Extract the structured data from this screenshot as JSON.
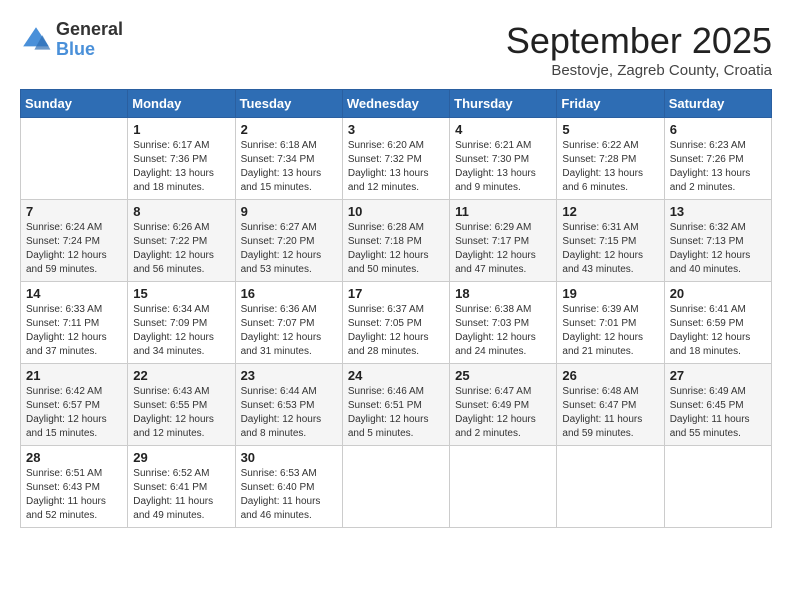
{
  "header": {
    "logo_general": "General",
    "logo_blue": "Blue",
    "month_title": "September 2025",
    "location": "Bestovje, Zagreb County, Croatia"
  },
  "days_of_week": [
    "Sunday",
    "Monday",
    "Tuesday",
    "Wednesday",
    "Thursday",
    "Friday",
    "Saturday"
  ],
  "weeks": [
    [
      {
        "day": "",
        "info": ""
      },
      {
        "day": "1",
        "info": "Sunrise: 6:17 AM\nSunset: 7:36 PM\nDaylight: 13 hours\nand 18 minutes."
      },
      {
        "day": "2",
        "info": "Sunrise: 6:18 AM\nSunset: 7:34 PM\nDaylight: 13 hours\nand 15 minutes."
      },
      {
        "day": "3",
        "info": "Sunrise: 6:20 AM\nSunset: 7:32 PM\nDaylight: 13 hours\nand 12 minutes."
      },
      {
        "day": "4",
        "info": "Sunrise: 6:21 AM\nSunset: 7:30 PM\nDaylight: 13 hours\nand 9 minutes."
      },
      {
        "day": "5",
        "info": "Sunrise: 6:22 AM\nSunset: 7:28 PM\nDaylight: 13 hours\nand 6 minutes."
      },
      {
        "day": "6",
        "info": "Sunrise: 6:23 AM\nSunset: 7:26 PM\nDaylight: 13 hours\nand 2 minutes."
      }
    ],
    [
      {
        "day": "7",
        "info": "Sunrise: 6:24 AM\nSunset: 7:24 PM\nDaylight: 12 hours\nand 59 minutes."
      },
      {
        "day": "8",
        "info": "Sunrise: 6:26 AM\nSunset: 7:22 PM\nDaylight: 12 hours\nand 56 minutes."
      },
      {
        "day": "9",
        "info": "Sunrise: 6:27 AM\nSunset: 7:20 PM\nDaylight: 12 hours\nand 53 minutes."
      },
      {
        "day": "10",
        "info": "Sunrise: 6:28 AM\nSunset: 7:18 PM\nDaylight: 12 hours\nand 50 minutes."
      },
      {
        "day": "11",
        "info": "Sunrise: 6:29 AM\nSunset: 7:17 PM\nDaylight: 12 hours\nand 47 minutes."
      },
      {
        "day": "12",
        "info": "Sunrise: 6:31 AM\nSunset: 7:15 PM\nDaylight: 12 hours\nand 43 minutes."
      },
      {
        "day": "13",
        "info": "Sunrise: 6:32 AM\nSunset: 7:13 PM\nDaylight: 12 hours\nand 40 minutes."
      }
    ],
    [
      {
        "day": "14",
        "info": "Sunrise: 6:33 AM\nSunset: 7:11 PM\nDaylight: 12 hours\nand 37 minutes."
      },
      {
        "day": "15",
        "info": "Sunrise: 6:34 AM\nSunset: 7:09 PM\nDaylight: 12 hours\nand 34 minutes."
      },
      {
        "day": "16",
        "info": "Sunrise: 6:36 AM\nSunset: 7:07 PM\nDaylight: 12 hours\nand 31 minutes."
      },
      {
        "day": "17",
        "info": "Sunrise: 6:37 AM\nSunset: 7:05 PM\nDaylight: 12 hours\nand 28 minutes."
      },
      {
        "day": "18",
        "info": "Sunrise: 6:38 AM\nSunset: 7:03 PM\nDaylight: 12 hours\nand 24 minutes."
      },
      {
        "day": "19",
        "info": "Sunrise: 6:39 AM\nSunset: 7:01 PM\nDaylight: 12 hours\nand 21 minutes."
      },
      {
        "day": "20",
        "info": "Sunrise: 6:41 AM\nSunset: 6:59 PM\nDaylight: 12 hours\nand 18 minutes."
      }
    ],
    [
      {
        "day": "21",
        "info": "Sunrise: 6:42 AM\nSunset: 6:57 PM\nDaylight: 12 hours\nand 15 minutes."
      },
      {
        "day": "22",
        "info": "Sunrise: 6:43 AM\nSunset: 6:55 PM\nDaylight: 12 hours\nand 12 minutes."
      },
      {
        "day": "23",
        "info": "Sunrise: 6:44 AM\nSunset: 6:53 PM\nDaylight: 12 hours\nand 8 minutes."
      },
      {
        "day": "24",
        "info": "Sunrise: 6:46 AM\nSunset: 6:51 PM\nDaylight: 12 hours\nand 5 minutes."
      },
      {
        "day": "25",
        "info": "Sunrise: 6:47 AM\nSunset: 6:49 PM\nDaylight: 12 hours\nand 2 minutes."
      },
      {
        "day": "26",
        "info": "Sunrise: 6:48 AM\nSunset: 6:47 PM\nDaylight: 11 hours\nand 59 minutes."
      },
      {
        "day": "27",
        "info": "Sunrise: 6:49 AM\nSunset: 6:45 PM\nDaylight: 11 hours\nand 55 minutes."
      }
    ],
    [
      {
        "day": "28",
        "info": "Sunrise: 6:51 AM\nSunset: 6:43 PM\nDaylight: 11 hours\nand 52 minutes."
      },
      {
        "day": "29",
        "info": "Sunrise: 6:52 AM\nSunset: 6:41 PM\nDaylight: 11 hours\nand 49 minutes."
      },
      {
        "day": "30",
        "info": "Sunrise: 6:53 AM\nSunset: 6:40 PM\nDaylight: 11 hours\nand 46 minutes."
      },
      {
        "day": "",
        "info": ""
      },
      {
        "day": "",
        "info": ""
      },
      {
        "day": "",
        "info": ""
      },
      {
        "day": "",
        "info": ""
      }
    ]
  ]
}
